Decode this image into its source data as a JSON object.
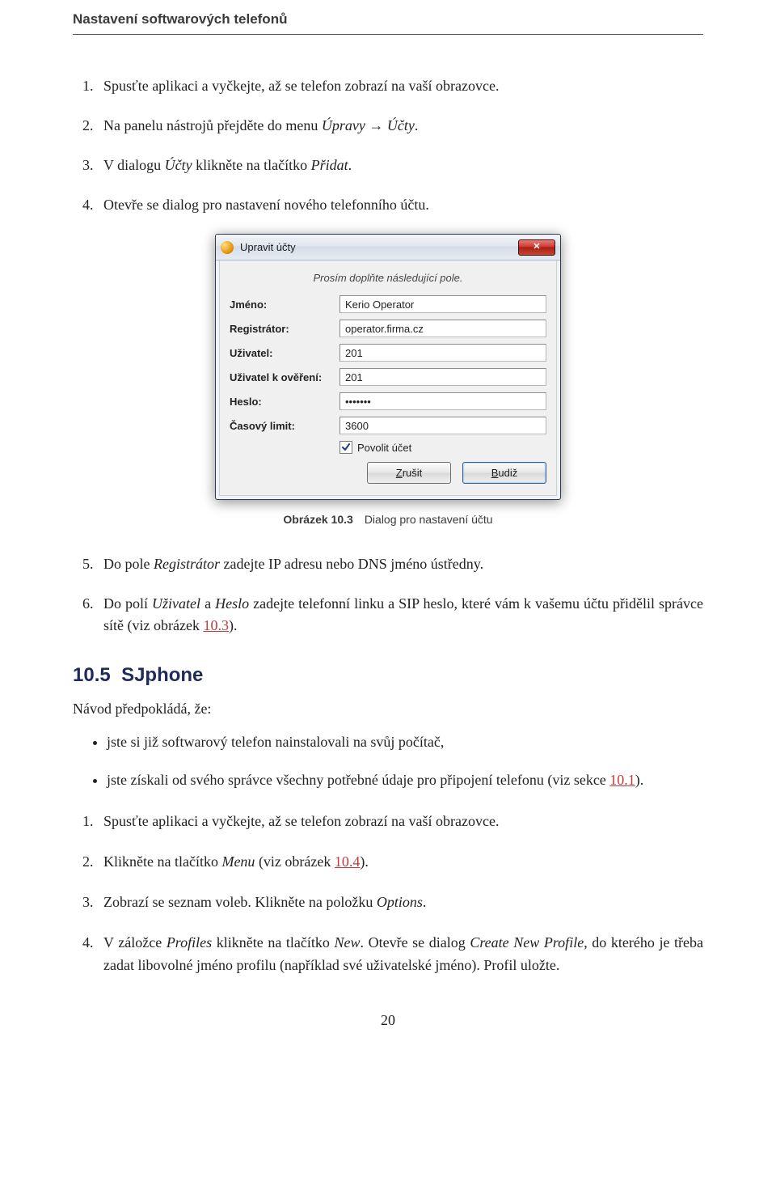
{
  "running_header": "Nastavení softwarových telefonů",
  "steps_top": [
    "Spusťte aplikaci a vyčkejte, až se telefon zobrazí na vaší obrazovce.",
    {
      "prefix": "Na panelu nástrojů přejděte do menu ",
      "italic1": "Úpravy",
      "arrow": " → ",
      "italic2": "Účty",
      "suffix": "."
    },
    {
      "prefix": "V dialogu ",
      "italic1": "Účty",
      "mid": " klikněte na tlačítko ",
      "italic2": "Přidat",
      "suffix": "."
    },
    "Otevře se dialog pro nastavení nového telefonního účtu."
  ],
  "dialog": {
    "title": "Upravit účty",
    "close_glyph": "✕",
    "prompt": "Prosím doplňte následující pole.",
    "rows": [
      {
        "label": "Jméno:",
        "value": "Kerio Operator"
      },
      {
        "label": "Registrátor:",
        "value": "operator.firma.cz"
      },
      {
        "label": "Uživatel:",
        "value": "201"
      },
      {
        "label": "Uživatel k ověření:",
        "value": "201"
      },
      {
        "label": "Heslo:",
        "value": "•••••••"
      },
      {
        "label": "Časový limit:",
        "value": "3600"
      }
    ],
    "checkbox_label": "Povolit účet",
    "checkbox_checked": true,
    "buttons": {
      "cancel": {
        "mnemonic": "Z",
        "rest": "rušit"
      },
      "ok": {
        "mnemonic": "B",
        "rest": "udiž"
      }
    }
  },
  "caption": {
    "name": "Obrázek 10.3",
    "text": "Dialog pro nastavení účtu"
  },
  "steps_mid": [
    {
      "prefix": "Do pole ",
      "italic1": "Registrátor",
      "suffix": " zadejte IP adresu nebo DNS jméno ústředny."
    },
    {
      "prefix": "Do polí ",
      "italic1": "Uživatel",
      "mid1": " a ",
      "italic2": "Heslo",
      "mid2": " zadejte telefonní linku a SIP heslo, které vám k vašemu účtu přidělil správce sítě (viz obrázek ",
      "ref": "10.3",
      "suffix": ")."
    }
  ],
  "section": {
    "num": "10.5",
    "title": "SJphone"
  },
  "intro": "Návod předpokládá, že:",
  "bullets": [
    "jste si již softwarový telefon nainstalovali na svůj počítač,",
    {
      "prefix": "jste získali od svého správce všechny potřebné údaje pro připojení telefonu (viz sekce ",
      "ref": "10.1",
      "suffix": ")."
    }
  ],
  "steps_bottom": [
    "Spusťte aplikaci a vyčkejte, až se telefon zobrazí na vaší obrazovce.",
    {
      "prefix": "Klikněte na tlačítko ",
      "italic1": "Menu",
      "mid": " (viz obrázek ",
      "ref": "10.4",
      "suffix": ")."
    },
    {
      "prefix": "Zobrazí se seznam voleb. Klikněte na položku ",
      "italic1": "Options",
      "suffix": "."
    },
    {
      "prefix": "V záložce ",
      "italic1": "Profiles",
      "mid1": " klikněte na tlačítko ",
      "italic2": "New",
      "mid2": ". Otevře se dialog ",
      "italic3": "Create New Profile",
      "suffix": ", do kterého je třeba zadat libovolné jméno profilu (například své uživatelské jméno). Profil uložte."
    }
  ],
  "page_number": "20"
}
